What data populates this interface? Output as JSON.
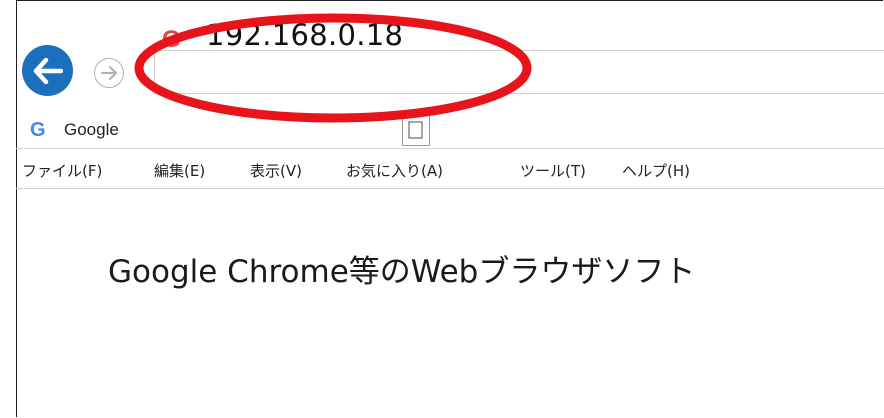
{
  "address_bar": {
    "url": "192.168.0.18",
    "site_icon_glyph": "G"
  },
  "tab": {
    "icon_glyph": "G",
    "title": "Google"
  },
  "menu": {
    "items": [
      "ファイル(F)",
      "編集(E)",
      "表示(V)",
      "お気に入り(A)",
      "ツール(T)",
      "ヘルプ(H)"
    ]
  },
  "content": {
    "caption": "Google Chrome等のWebブラウザソフト"
  },
  "colors": {
    "back_button": "#1b6fbd",
    "highlight_ellipse": "#e8141b",
    "google_g": "#e9453d"
  },
  "icons": {
    "back": "back-arrow-icon",
    "forward": "forward-arrow-icon",
    "site": "google-g-icon",
    "new_tab": "new-tab-icon"
  }
}
